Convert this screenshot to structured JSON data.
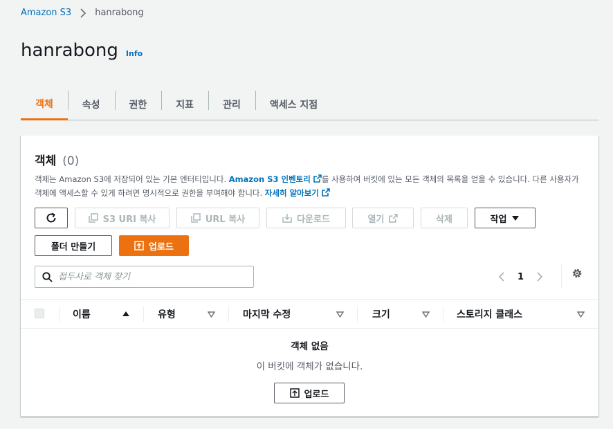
{
  "breadcrumb": {
    "root": "Amazon S3",
    "current": "hanrabong"
  },
  "page": {
    "title": "hanrabong",
    "info": "Info"
  },
  "tabs": [
    {
      "label": "객체"
    },
    {
      "label": "속성"
    },
    {
      "label": "권한"
    },
    {
      "label": "지표"
    },
    {
      "label": "관리"
    },
    {
      "label": "액세스 지점"
    }
  ],
  "objects": {
    "title": "객체",
    "count": "(0)",
    "desc_part1": "객체는 Amazon S3에 저장되어 있는 기본 엔터티입니다. ",
    "inventory_link": "Amazon S3 인벤토리",
    "desc_part2": "를 사용하여 버킷에 있는 모든 객체의 목록을 얻을 수 있습니다. 다른 사용자가 객체에 액세스할 수 있게 하려면 명시적으로 권한을 부여해야 합니다. ",
    "learn_more": "자세히 알아보기"
  },
  "toolbar": {
    "copy_s3_uri": "S3 URI 복사",
    "copy_url": "URL 복사",
    "download": "다운로드",
    "open": "열기",
    "delete": "삭제",
    "actions": "작업",
    "create_folder": "폴더 만들기",
    "upload": "업로드"
  },
  "search": {
    "placeholder": "접두사로 객체 찾기"
  },
  "pagination": {
    "page": "1"
  },
  "table": {
    "columns": [
      "이름",
      "유형",
      "마지막 수정",
      "크기",
      "스토리지 클래스"
    ]
  },
  "empty": {
    "title": "객체 없음",
    "desc": "이 버킷에 객체가 없습니다.",
    "upload": "업로드"
  },
  "colors": {
    "accent": "#ec7211",
    "link": "#0073bb"
  }
}
